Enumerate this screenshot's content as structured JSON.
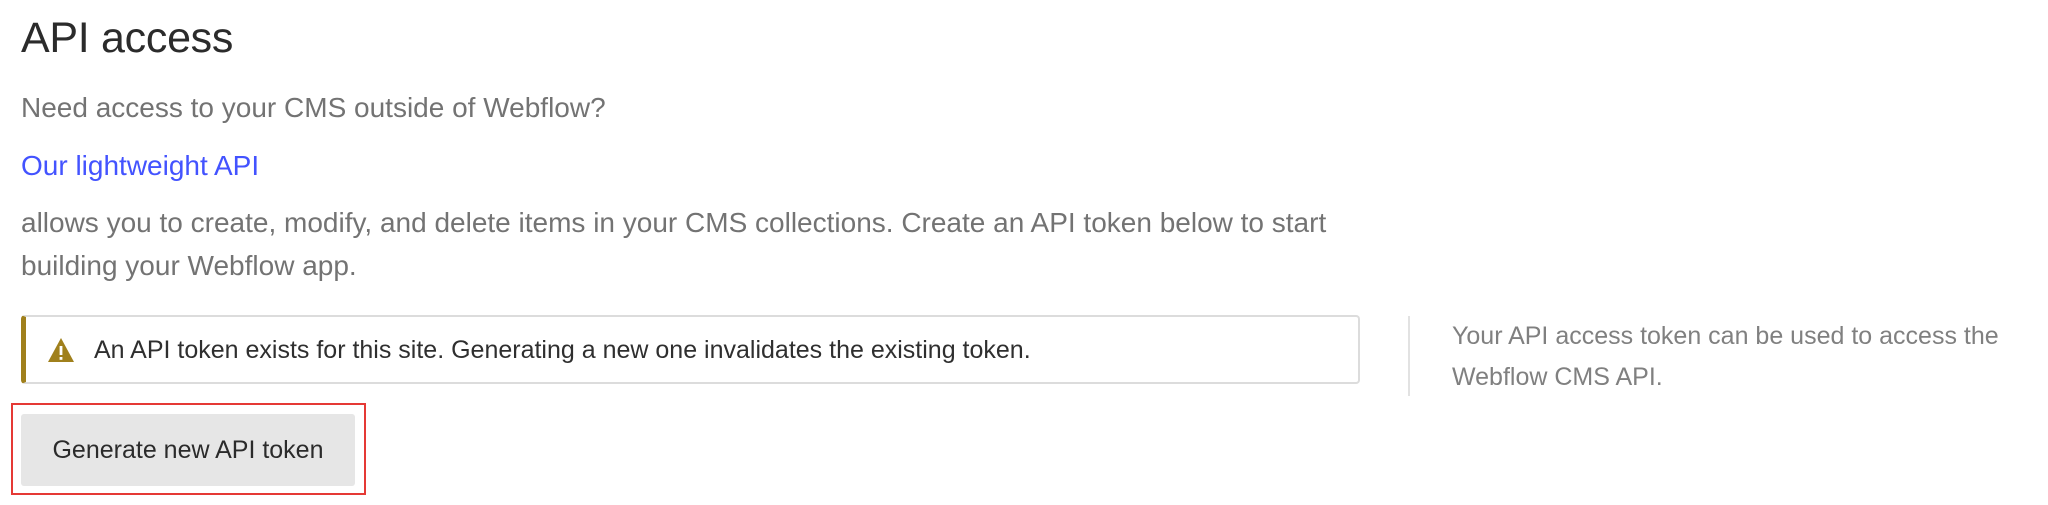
{
  "section": {
    "title": "API access",
    "intro": "Need access to your CMS outside of Webflow?",
    "link_text": "Our lightweight API",
    "description": "allows you to create, modify, and delete items in your CMS collections. Create an API token below to start building your Webflow app."
  },
  "alert": {
    "icon": "warning-icon",
    "text": "An API token exists for this site. Generating a new one invalidates the existing token.",
    "accent_color": "#a0801c"
  },
  "side_note": {
    "text": "Your API access token can be used to access the Webflow CMS API."
  },
  "actions": {
    "generate_label": "Generate new API token"
  },
  "colors": {
    "link": "#4353ff",
    "highlight": "#e53935",
    "button_bg": "#e6e6e6"
  }
}
